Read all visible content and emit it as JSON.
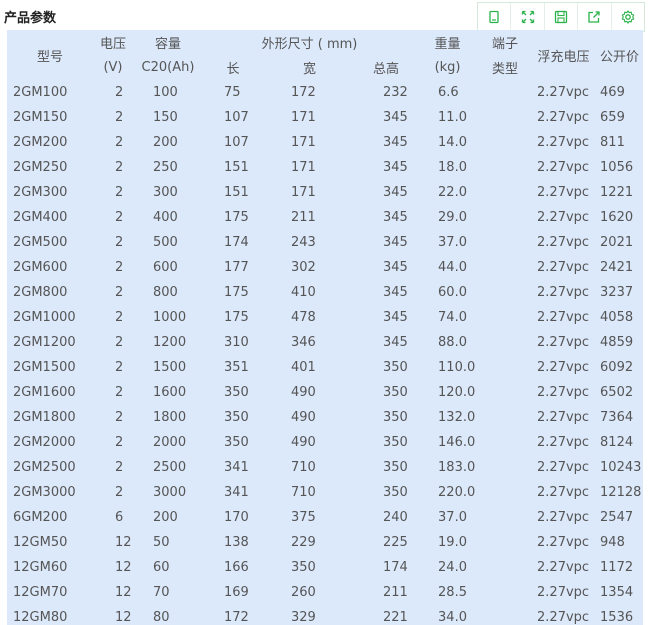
{
  "page": {
    "title": "产品参数"
  },
  "toolbar": {
    "icons": [
      "copy-icon",
      "fullscreen-icon",
      "save-icon",
      "share-icon",
      "settings-icon"
    ]
  },
  "table": {
    "headers": {
      "model": "型号",
      "voltage": "电压",
      "voltage_unit": "(V)",
      "capacity": "容量",
      "capacity_unit": "C20(Ah)",
      "dimensions": "外形尺寸 ( mm)",
      "length": "长",
      "width": "宽",
      "height": "总高",
      "weight": "重量",
      "weight_unit": "(kg)",
      "terminal": "端子",
      "terminal_type": "类型",
      "float_voltage": "浮充电压",
      "price": "公开价"
    },
    "rows": [
      [
        "2GM100",
        "2",
        "100",
        "75",
        "172",
        "232",
        "6.6",
        "",
        "2.27vpc",
        "469"
      ],
      [
        "2GM150",
        "2",
        "150",
        "107",
        "171",
        "345",
        "11.0",
        "",
        "2.27vpc",
        "659"
      ],
      [
        "2GM200",
        "2",
        "200",
        "107",
        "171",
        "345",
        "14.0",
        "",
        "2.27vpc",
        "811"
      ],
      [
        "2GM250",
        "2",
        "250",
        "151",
        "171",
        "345",
        "18.0",
        "",
        "2.27vpc",
        "1056"
      ],
      [
        "2GM300",
        "2",
        "300",
        "151",
        "171",
        "345",
        "22.0",
        "",
        "2.27vpc",
        "1221"
      ],
      [
        "2GM400",
        "2",
        "400",
        "175",
        "211",
        "345",
        "29.0",
        "",
        "2.27vpc",
        "1620"
      ],
      [
        "2GM500",
        "2",
        "500",
        "174",
        "243",
        "345",
        "37.0",
        "",
        "2.27vpc",
        "2021"
      ],
      [
        "2GM600",
        "2",
        "600",
        "177",
        "302",
        "345",
        "44.0",
        "",
        "2.27vpc",
        "2421"
      ],
      [
        "2GM800",
        "2",
        "800",
        "175",
        "410",
        "345",
        "60.0",
        "",
        "2.27vpc",
        "3237"
      ],
      [
        "2GM1000",
        "2",
        "1000",
        "175",
        "478",
        "345",
        "74.0",
        "",
        "2.27vpc",
        "4058"
      ],
      [
        "2GM1200",
        "2",
        "1200",
        "310",
        "346",
        "345",
        "88.0",
        "",
        "2.27vpc",
        "4859"
      ],
      [
        "2GM1500",
        "2",
        "1500",
        "351",
        "401",
        "350",
        "110.0",
        "",
        "2.27vpc",
        "6092"
      ],
      [
        "2GM1600",
        "2",
        "1600",
        "350",
        "490",
        "350",
        "120.0",
        "",
        "2.27vpc",
        "6502"
      ],
      [
        "2GM1800",
        "2",
        "1800",
        "350",
        "490",
        "350",
        "132.0",
        "",
        "2.27vpc",
        "7364"
      ],
      [
        "2GM2000",
        "2",
        "2000",
        "350",
        "490",
        "350",
        "146.0",
        "",
        "2.27vpc",
        "8124"
      ],
      [
        "2GM2500",
        "2",
        "2500",
        "341",
        "710",
        "350",
        "183.0",
        "",
        "2.27vpc",
        "10243"
      ],
      [
        "2GM3000",
        "2",
        "3000",
        "341",
        "710",
        "350",
        "220.0",
        "",
        "2.27vpc",
        "12128"
      ],
      [
        "6GM200",
        "6",
        "200",
        "170",
        "375",
        "240",
        "37.0",
        "",
        "2.27vpc",
        "2547"
      ],
      [
        "12GM50",
        "12",
        "50",
        "138",
        "229",
        "225",
        "19.0",
        "",
        "2.27vpc",
        "948"
      ],
      [
        "12GM60",
        "12",
        "60",
        "166",
        "350",
        "174",
        "24.0",
        "",
        "2.27vpc",
        "1172"
      ],
      [
        "12GM70",
        "12",
        "70",
        "169",
        "260",
        "211",
        "28.5",
        "",
        "2.27vpc",
        "1354"
      ],
      [
        "12GM80",
        "12",
        "80",
        "172",
        "329",
        "221",
        "34.0",
        "",
        "2.27vpc",
        "1536"
      ]
    ]
  },
  "colors": {
    "panel_bg": "#dce9fb",
    "toolbar_icon": "#2bb24c",
    "text": "#555555"
  }
}
